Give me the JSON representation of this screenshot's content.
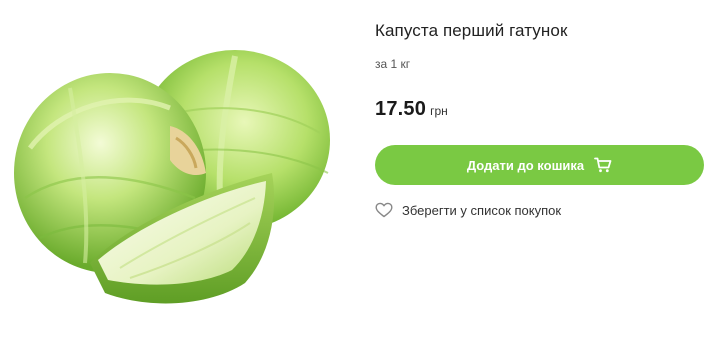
{
  "product": {
    "title": "Капуста перший гатунок",
    "unit": "за 1 кг",
    "price": "17.50",
    "currency": "грн",
    "image_alt": "cabbage"
  },
  "actions": {
    "add_to_cart_label": "Додати до кошика",
    "save_to_list_label": "Зберегти у список покупок"
  },
  "icons": {
    "cart": "cart-icon",
    "wishlist": "heart-outline-icon"
  },
  "colors": {
    "accent": "#7ac943",
    "button_text": "#ffffff",
    "heart_outline": "#888888"
  }
}
